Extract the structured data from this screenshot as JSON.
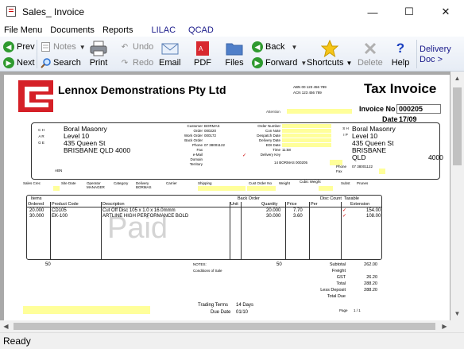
{
  "window": {
    "title": "Sales_ Invoice",
    "minimize": "—",
    "maximize": "☐",
    "close": "✕"
  },
  "menu": {
    "file": "File Menu",
    "documents": "Documents",
    "reports": "Reports",
    "tab_lilac": "LILAC",
    "tab_qcad": "QCAD"
  },
  "toolbar": {
    "prev": "Prev",
    "next": "Next",
    "notes": "Notes",
    "search": "Search",
    "undo": "Undo",
    "redo": "Redo",
    "print": "Print",
    "email": "Email",
    "pdf": "PDF",
    "files": "Files",
    "back": "Back",
    "forward": "Forward",
    "shortcuts": "Shortcuts",
    "delete": "Delete",
    "help": "Help",
    "delivery_doc": "Delivery Doc >"
  },
  "invoice": {
    "company": "Lennox Demonstrations Pty Ltd",
    "abn_line1": "ABN 00 123 456 789",
    "abn_line2": "ACN 123 456 789",
    "doc_type": "Tax Invoice",
    "attention_label": "Attention",
    "invoice_no_label": "Invoice No",
    "invoice_no": "000205",
    "date_label": "Date",
    "date": "17/09",
    "charge_letters": "C H A R G E",
    "bill_to": [
      "Boral Masonry",
      "Level 10",
      "435 Queen St",
      "BRISBANE QLD 4000"
    ],
    "abn_label": "ABN",
    "mid_labels": [
      "Customer",
      "Order",
      "Work Order",
      "Back Order",
      "Phone",
      "Fax",
      "e-Mail",
      "Domain",
      "Territory"
    ],
    "mid_values": [
      "BORMAS",
      "000220",
      "000172",
      "",
      "07 38001122",
      "",
      "",
      "",
      ""
    ],
    "mid2_labels": [
      "Order Number",
      "Con Note",
      "Despatch Date",
      "Delivery Date",
      "EDI Date",
      "Time",
      "Delivery Key"
    ],
    "mid2_values": [
      "",
      "",
      "",
      "",
      "",
      "11:58",
      ""
    ],
    "delivery_key_row": "14    BORMAS        000205",
    "ship_letters": "S H I P",
    "ship_to": [
      "Boral Masonry",
      "Level 10",
      "435 Queen St",
      "BRISBANE",
      "QLD"
    ],
    "ship_postcode": "4000",
    "ship_phone_label": "Phone",
    "ship_phone": "07 38001122",
    "ship_fax_label": "Fax",
    "row2_labels": [
      "Sales Crec",
      "Site Date",
      "Operator",
      "Category",
      "Delivery",
      "Carrier",
      "Shipping",
      "Cust Order No",
      "Weight",
      "Cubic Weight",
      "Subst",
      "Prunes"
    ],
    "row2_values": [
      "",
      "",
      "MANAGER",
      "",
      "BORMAS",
      "",
      "",
      "",
      "",
      "",
      "",
      ""
    ],
    "items_label": "Items",
    "back_order_label": "Back Order",
    "disc_label": "Disc Count",
    "taxable_label": "Taxable",
    "columns": [
      "Ordered",
      "Product Code",
      "Description",
      "Unit",
      "Quantity",
      "Price",
      "Per",
      "Extension"
    ],
    "lines": [
      {
        "ordered": "20.000",
        "code": "CD105",
        "desc": "Cut Off Disc 105 x 1.0 x 16.0mmm",
        "unit": "",
        "qty": "20.000",
        "price": "7.70",
        "per": "",
        "tax": "✓",
        "ext": "154.00"
      },
      {
        "ordered": "30.000",
        "code": "EK-100",
        "desc": "ARTLINE HIGH PERFORMANCE BOLD",
        "unit": "",
        "qty": "30.000",
        "price": "3.60",
        "per": "",
        "tax": "✓",
        "ext": "108.00"
      }
    ],
    "paid_stamp": "Paid",
    "count_left": "50",
    "count_mid": "50",
    "notes_label": "NOTES:",
    "conditions": "Conditions of Sale",
    "totals": [
      {
        "label": "Subtotal",
        "value": "262.00"
      },
      {
        "label": "Freight",
        "value": ""
      },
      {
        "label": "GST",
        "value": "26.20"
      },
      {
        "label": "Total",
        "value": "288.20"
      },
      {
        "label": "Less Deposit",
        "value": "288.20"
      },
      {
        "label": "Total Due",
        "value": ""
      }
    ],
    "trading_terms_label": "Trading Terms",
    "trading_terms": "14 Days",
    "due_date_label": "Due Date",
    "due_date": "01/10",
    "page_label": "Page",
    "page_of": "1    /    1"
  },
  "status": "Ready",
  "colors": {
    "highlight": "#ffff9a",
    "logo_red": "#d52027",
    "accent_blue": "#1a1a8a"
  }
}
